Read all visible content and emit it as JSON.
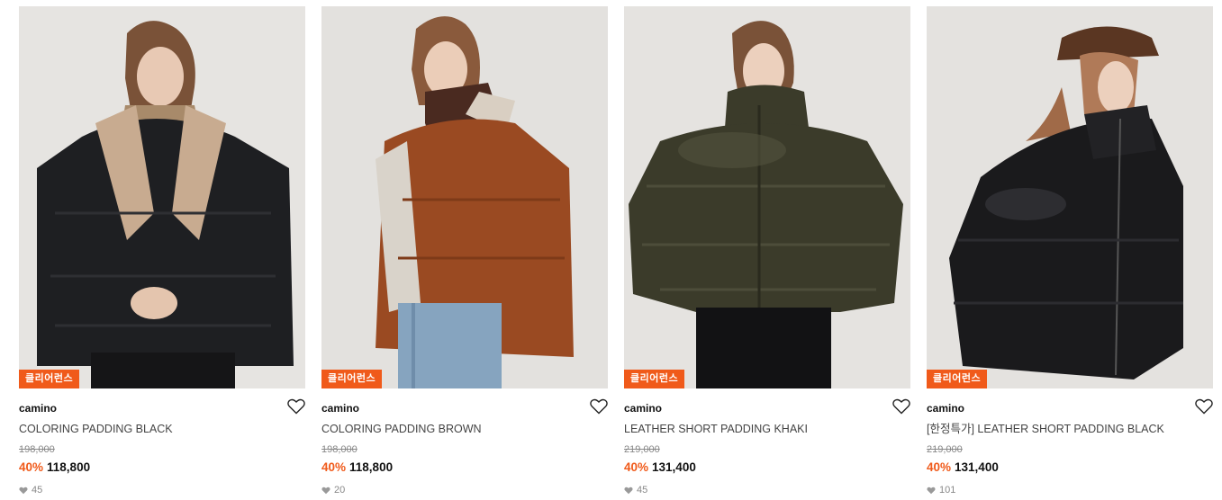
{
  "products": [
    {
      "badge": "클리어런스",
      "brand": "camino",
      "name": "COLORING PADDING BLACK",
      "original_price": "198,000",
      "discount": "40%",
      "sale_price": "118,800",
      "likes": "45",
      "jacket_color": "#1e1f22"
    },
    {
      "badge": "클리어런스",
      "brand": "camino",
      "name": "COLORING PADDING BROWN",
      "original_price": "198,000",
      "discount": "40%",
      "sale_price": "118,800",
      "likes": "20",
      "jacket_color": "#9a4a22"
    },
    {
      "badge": "클리어런스",
      "brand": "camino",
      "name": "LEATHER SHORT PADDING KHAKI",
      "original_price": "219,000",
      "discount": "40%",
      "sale_price": "131,400",
      "likes": "45",
      "jacket_color": "#3b3b2a"
    },
    {
      "badge": "클리어런스",
      "brand": "camino",
      "name": "[한정특가] LEATHER SHORT PADDING BLACK",
      "original_price": "219,000",
      "discount": "40%",
      "sale_price": "131,400",
      "likes": "101",
      "jacket_color": "#1a1a1c"
    }
  ],
  "colors": {
    "accent": "#f05a1a",
    "image_bg": "#e4e2df"
  }
}
